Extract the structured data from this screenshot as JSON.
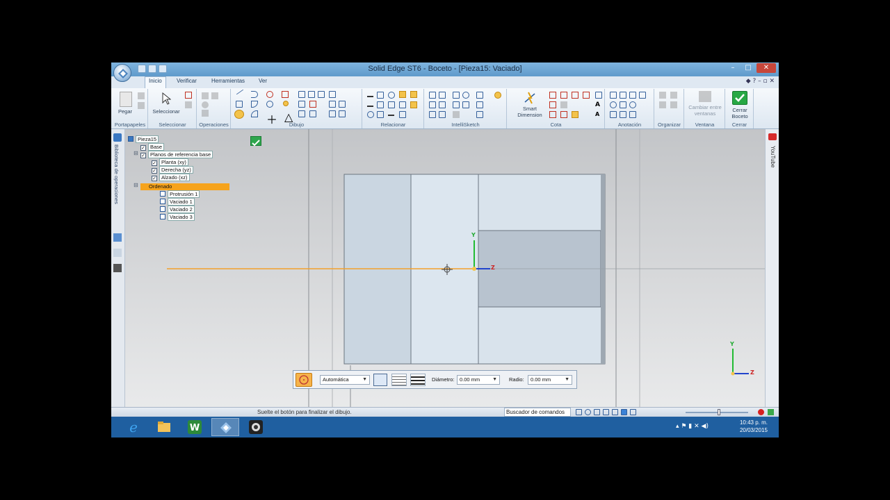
{
  "window": {
    "title": "Solid Edge ST6 - Boceto - [Pieza15: Vaciado]"
  },
  "ribbon_tabs": [
    "Inicio",
    "Verificar",
    "Herramientas",
    "Ver"
  ],
  "ribbon": {
    "buttons": {
      "pegar": "Pegar",
      "seleccionar": "Seleccionar",
      "smart_dimension": "Smart Dimension",
      "cambiar_ventanas": "Cambiar entre ventanas",
      "cerrar_boceto": "Cerrar Boceto"
    },
    "groups": [
      "Portapapeles",
      "Seleccionar",
      "Operaciones",
      "Dibujo",
      "Relacionar",
      "IntelliSketch",
      "Cota",
      "Anotación",
      "Organizar",
      "Ventana",
      "Cerrar"
    ]
  },
  "sidebar": {
    "vertical_label": "Biblioteca de operaciones"
  },
  "tree": {
    "root": "Pieza15",
    "base": "Base",
    "planes_group": "Planos de referencia base",
    "planes": [
      "Planta (xy)",
      "Derecha (yz)",
      "Alzado (xz)"
    ],
    "ordered": "Ordenado",
    "features": [
      "Protrusión 1",
      "Vaciado 1",
      "Vaciado 2",
      "Vaciado 3"
    ]
  },
  "command_bar": {
    "mode": "Automática",
    "diameter_label": "Diámetro:",
    "diameter_value": "0.00 mm",
    "radius_label": "Radio:",
    "radius_value": "0.00 mm"
  },
  "axes": {
    "y": "Y",
    "z": "Z"
  },
  "right_bar": {
    "label": "YouTube"
  },
  "status": {
    "message": "Suelte el botón para finalizar el dibujo.",
    "command_finder": "Buscador de comandos"
  },
  "taskbar": {
    "time": "10:43 p. m.",
    "date": "20/03/2015"
  },
  "colors": {
    "accent": "#f6a31c",
    "titlebar": "#6aa3d3",
    "taskbar": "#1f5fa0"
  }
}
